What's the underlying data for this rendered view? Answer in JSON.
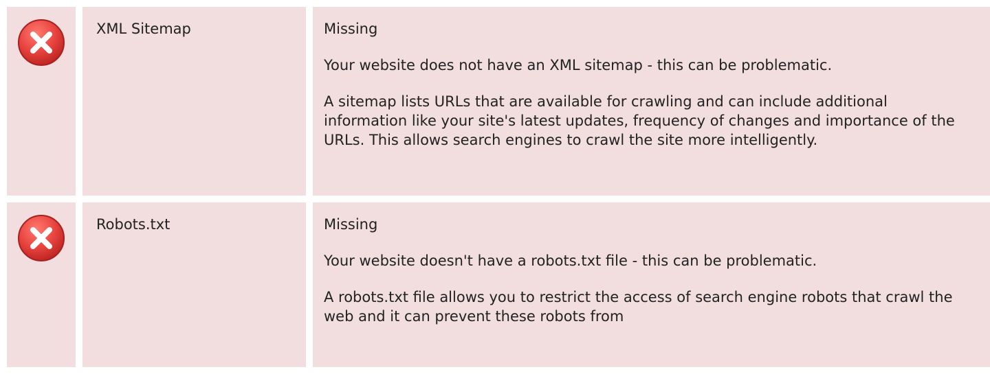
{
  "checks": [
    {
      "name": "XML Sitemap",
      "status": "Missing",
      "status_icon": "error-icon",
      "summary": "Your website does not have an XML sitemap - this can be problematic.",
      "details": "A sitemap lists URLs that are available for crawling and can include additional information like your site's latest updates, frequency of changes and importance of the URLs. This allows search engines to crawl the site more intelligently."
    },
    {
      "name": "Robots.txt",
      "status": "Missing",
      "status_icon": "error-icon",
      "summary": "Your website doesn't have a robots.txt file - this can be problematic.",
      "details": "A robots.txt file allows you to restrict the access of search engine robots that crawl the web and it can prevent these robots from"
    }
  ],
  "colors": {
    "row_background": "#f2dede",
    "icon_red": "#e8433f",
    "icon_border": "#a82020"
  }
}
